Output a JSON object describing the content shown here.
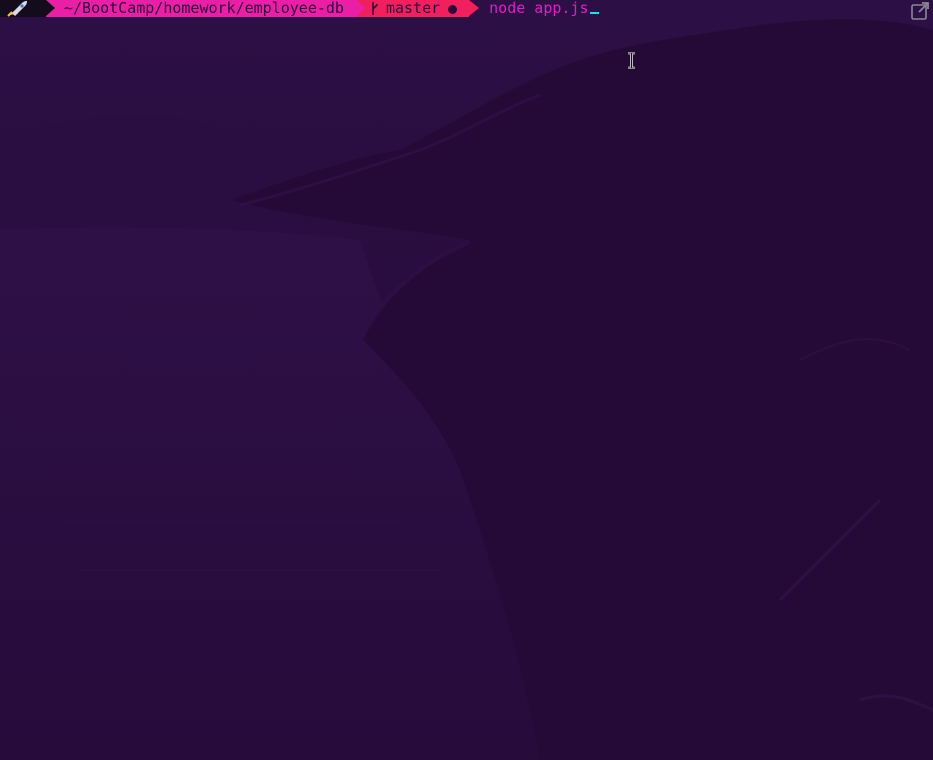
{
  "prompt": {
    "segments": {
      "path": "~/BootCamp/homework/employee-db",
      "branch": "master"
    },
    "command": "node app.js",
    "icons": {
      "status": "rocket-icon",
      "branch": "git-branch-icon",
      "dirty": "dirty-indicator-dot"
    }
  },
  "window": {
    "corner_icon": "popout-window-icon"
  },
  "colors": {
    "background": "#260b3b",
    "path_segment": "#ea1fa6",
    "git_segment": "#f11f5e",
    "command_text": "#e21cc7",
    "cursor": "#19e2ef"
  }
}
